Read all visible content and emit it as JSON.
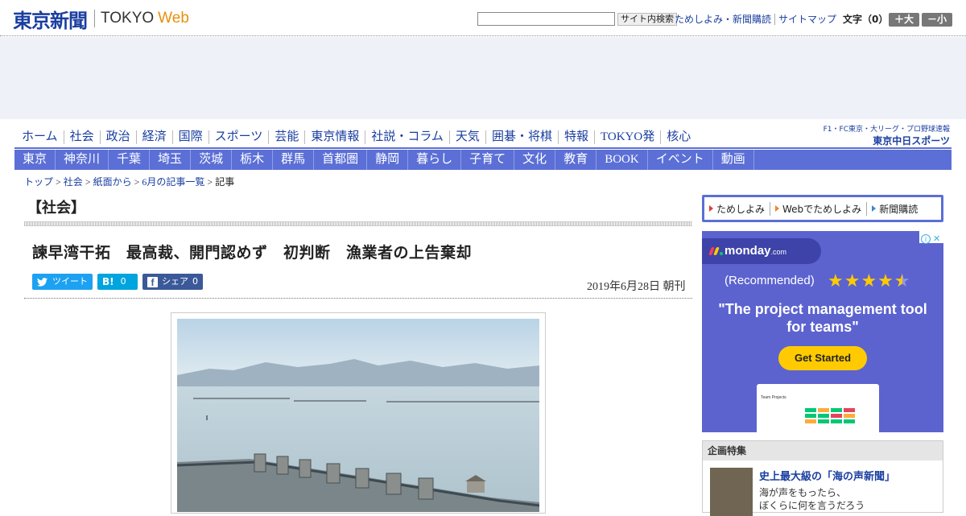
{
  "header": {
    "logo_jp": "東京新聞",
    "logo_en": "TOKYO",
    "logo_web": "Web",
    "search_button": "サイト内検索",
    "links": [
      "ためしよみ・新聞購読",
      "サイトマップ"
    ],
    "font_size_label": "文字（0）",
    "font_up": "＋大",
    "font_down": "－小"
  },
  "main_nav": [
    "ホーム",
    "社会",
    "政治",
    "経済",
    "国際",
    "スポーツ",
    "芸能",
    "東京情報",
    "社説・コラム",
    "天気",
    "囲碁・将棋",
    "特報",
    "TOKYO発",
    "核心"
  ],
  "chunichi_banner": {
    "line1": "F1・FC東京・大リーグ・プロ野球速報",
    "line2": "東京中日スポーツ"
  },
  "sub_nav": [
    "東京",
    "神奈川",
    "千葉",
    "埼玉",
    "茨城",
    "栃木",
    "群馬",
    "首都圏",
    "静岡",
    "暮らし",
    "子育て",
    "文化",
    "教育",
    "BOOK",
    "イベント",
    "動画"
  ],
  "breadcrumb": {
    "items": [
      "トップ",
      "社会",
      "紙面から",
      "6月の記事一覧"
    ],
    "current": "記事",
    "sep": " > "
  },
  "article": {
    "section": "【社会】",
    "headline": "諫早湾干拓　最高裁、開門認めず　初判断　漁業者の上告棄却",
    "date": "2019年6月28日 朝刊",
    "share": {
      "tweet": "ツイート",
      "hatena_icon": "B!",
      "hatena_count": "0",
      "facebook_label": "シェア",
      "facebook_count": "0"
    }
  },
  "sidebar": {
    "links": [
      "ためしよみ",
      "Webでためしよみ",
      "新聞購読"
    ],
    "ad": {
      "brand": "monday",
      "brand_suffix": ".com",
      "recommended": "(Recommended)",
      "rating": 4.5,
      "headline": "\"The project management tool for teams\"",
      "cta": "Get Started",
      "screenshot_title": "Team Projects"
    },
    "feature": {
      "heading": "企画特集",
      "title": "史上最大級の「海の声新聞」",
      "text_line1": "海が声をもったら、",
      "text_line2": "ぼくらに何を言うだろう"
    }
  },
  "colors": {
    "brand_blue": "#1a3ea0",
    "nav_bar": "#5b6fd6",
    "accent_orange": "#e8900b",
    "twitter": "#1da1f2",
    "hatena": "#00a4de",
    "facebook": "#3b5998",
    "ad_bg": "#5c63cf",
    "ad_cta": "#ffcb00"
  },
  "icons": {
    "twitter": "twitter-bird-icon",
    "hatena": "hatena-bookmark-icon",
    "facebook": "facebook-icon",
    "arrow": "triangle-arrow-icon",
    "adchoices": "adchoices-icon"
  }
}
